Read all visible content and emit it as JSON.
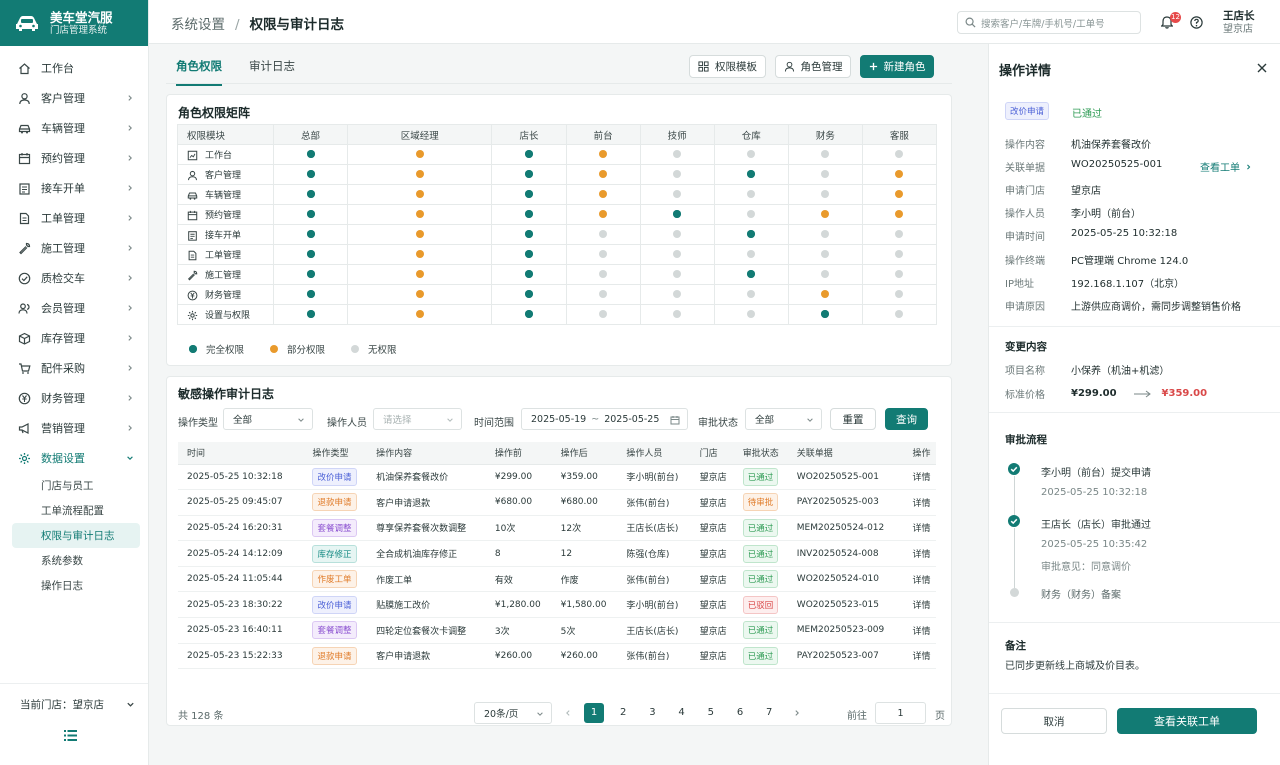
{
  "app": {
    "name": "美车堂汽服",
    "subtitle": "门店管理系统"
  },
  "sidebar": {
    "items": [
      {
        "label": "工作台",
        "icon": "home-icon"
      },
      {
        "label": "客户管理",
        "icon": "user-icon"
      },
      {
        "label": "车辆管理",
        "icon": "car-icon"
      },
      {
        "label": "预约管理",
        "icon": "calendar-icon"
      },
      {
        "label": "接车开单",
        "icon": "clipboard-icon"
      },
      {
        "label": "工单管理",
        "icon": "document-icon"
      },
      {
        "label": "施工管理",
        "icon": "wrench-icon"
      },
      {
        "label": "质检交车",
        "icon": "check-circle-icon"
      },
      {
        "label": "会员管理",
        "icon": "member-icon"
      },
      {
        "label": "库存管理",
        "icon": "box-icon"
      },
      {
        "label": "配件采购",
        "icon": "cart-icon"
      },
      {
        "label": "财务管理",
        "icon": "money-icon"
      },
      {
        "label": "营销管理",
        "icon": "megaphone-icon"
      },
      {
        "label": "数据设置",
        "icon": "gear-icon"
      }
    ],
    "sub_items": [
      "门店与员工",
      "工单流程配置",
      "权限与审计日志",
      "系统参数",
      "操作日志"
    ],
    "current_store": "当前门店：望京店"
  },
  "header": {
    "breadcrumb": [
      "系统设置",
      "权限与审计日志"
    ],
    "search_placeholder": "搜索客户/车牌/手机号/工单号",
    "notifications": "12",
    "user_name": "王店长",
    "user_store": "望京店"
  },
  "tabs": [
    "角色权限",
    "审计日志"
  ],
  "actions": {
    "template": "权限模板",
    "roles": "角色管理",
    "new_role": "新建角色"
  },
  "matrix": {
    "title": "角色权限矩阵",
    "columns": [
      "权限模块",
      "总部",
      "区域经理",
      "店长",
      "前台",
      "技师",
      "仓库",
      "财务",
      "客服"
    ],
    "rows": [
      {
        "module": "工作台",
        "icon": "dashboard-icon",
        "levels": [
          "full",
          "part",
          "full",
          "part",
          "none",
          "none",
          "none",
          "none"
        ]
      },
      {
        "module": "客户管理",
        "icon": "user-icon",
        "levels": [
          "full",
          "part",
          "full",
          "part",
          "none",
          "full",
          "none",
          "part"
        ]
      },
      {
        "module": "车辆管理",
        "icon": "car-icon",
        "levels": [
          "full",
          "part",
          "full",
          "part",
          "none",
          "none",
          "none",
          "part"
        ]
      },
      {
        "module": "预约管理",
        "icon": "calendar-icon",
        "levels": [
          "full",
          "part",
          "full",
          "part",
          "full",
          "none",
          "part",
          "part"
        ]
      },
      {
        "module": "接车开单",
        "icon": "clipboard-icon",
        "levels": [
          "full",
          "part",
          "full",
          "none",
          "none",
          "full",
          "none",
          "none"
        ]
      },
      {
        "module": "工单管理",
        "icon": "document-icon",
        "levels": [
          "full",
          "part",
          "full",
          "none",
          "none",
          "none",
          "none",
          "none"
        ]
      },
      {
        "module": "施工管理",
        "icon": "wrench-icon",
        "levels": [
          "full",
          "part",
          "full",
          "none",
          "none",
          "full",
          "none",
          "none"
        ]
      },
      {
        "module": "财务管理",
        "icon": "money-icon",
        "levels": [
          "full",
          "part",
          "full",
          "none",
          "none",
          "none",
          "part",
          "none"
        ]
      },
      {
        "module": "设置与权限",
        "icon": "gear-icon",
        "levels": [
          "full",
          "part",
          "full",
          "none",
          "none",
          "none",
          "full",
          "none"
        ]
      }
    ],
    "legend": [
      "完全权限",
      "部分权限",
      "无权限"
    ]
  },
  "audit": {
    "title": "敏感操作审计日志",
    "filters": {
      "type_label": "操作类型",
      "type_value": "全部",
      "user_label": "操作人员",
      "user_placeholder": "请选择",
      "range_label": "时间范围",
      "date_from": "2025-05-19",
      "date_to": "2025-05-25",
      "status_label": "审批状态",
      "status_value": "全部",
      "reset": "重置",
      "query": "查询"
    },
    "columns": [
      "时间",
      "操作类型",
      "操作内容",
      "操作前",
      "操作后",
      "操作人员",
      "门店",
      "审批状态",
      "关联单据",
      "操作"
    ],
    "rows": [
      {
        "time": "2025-05-25 10:32:18",
        "type": "改价申请",
        "tc": "blue",
        "content": "机油保养套餐改价",
        "before": "¥299.00",
        "after": "¥359.00",
        "user": "李小明(前台)",
        "store": "望京店",
        "status": "已通过",
        "sc": "green",
        "ref": "WO20250525-001",
        "action": "详情"
      },
      {
        "time": "2025-05-25 09:45:07",
        "type": "退款申请",
        "tc": "orange",
        "content": "客户申请退款",
        "before": "¥680.00",
        "after": "¥680.00",
        "user": "张伟(前台)",
        "store": "望京店",
        "status": "待审批",
        "sc": "orange",
        "ref": "PAY20250525-003",
        "action": "详情"
      },
      {
        "time": "2025-05-24 16:20:31",
        "type": "套餐调整",
        "tc": "purple",
        "content": "尊享保养套餐次数调整",
        "before": "10次",
        "after": "12次",
        "user": "王店长(店长)",
        "store": "望京店",
        "status": "已通过",
        "sc": "green",
        "ref": "MEM20250524-012",
        "action": "详情"
      },
      {
        "time": "2025-05-24 14:12:09",
        "type": "库存修正",
        "tc": "teal",
        "content": "全合成机油库存修正",
        "before": "8",
        "after": "12",
        "user": "陈强(仓库)",
        "store": "望京店",
        "status": "已通过",
        "sc": "green",
        "ref": "INV20250524-008",
        "action": "详情"
      },
      {
        "time": "2025-05-24 11:05:44",
        "type": "作废工单",
        "tc": "orange",
        "content": "作废工单",
        "before": "有效",
        "after": "作废",
        "user": "张伟(前台)",
        "store": "望京店",
        "status": "已通过",
        "sc": "green",
        "ref": "WO20250524-010",
        "action": "详情"
      },
      {
        "time": "2025-05-23 18:30:22",
        "type": "改价申请",
        "tc": "blue",
        "content": "贴膜施工改价",
        "before": "¥1,280.00",
        "after": "¥1,580.00",
        "user": "李小明(前台)",
        "store": "望京店",
        "status": "已驳回",
        "sc": "red",
        "ref": "WO20250523-015",
        "action": "详情"
      },
      {
        "time": "2025-05-23 16:40:11",
        "type": "套餐调整",
        "tc": "purple",
        "content": "四轮定位套餐次卡调整",
        "before": "3次",
        "after": "5次",
        "user": "王店长(店长)",
        "store": "望京店",
        "status": "已通过",
        "sc": "green",
        "ref": "MEM20250523-009",
        "action": "详情"
      },
      {
        "time": "2025-05-23 15:22:33",
        "type": "退款申请",
        "tc": "orange",
        "content": "客户申请退款",
        "before": "¥260.00",
        "after": "¥260.00",
        "user": "张伟(前台)",
        "store": "望京店",
        "status": "已通过",
        "sc": "green",
        "ref": "PAY20250523-007",
        "action": "详情"
      }
    ],
    "pager": {
      "total": "共 128 条",
      "size": "20条/页",
      "pages": [
        "1",
        "2",
        "3",
        "4",
        "5",
        "6",
        "7"
      ],
      "goto": "前往",
      "goto_value": "1",
      "page_unit": "页"
    }
  },
  "detail": {
    "title": "操作详情",
    "type_tag": "改价申请",
    "status": "已通过",
    "fields": [
      {
        "k": "操作内容",
        "v": "机油保养套餐改价"
      },
      {
        "k": "关联单据",
        "v": "WO20250525-001"
      },
      {
        "k": "申请门店",
        "v": "望京店"
      },
      {
        "k": "操作人员",
        "v": "李小明（前台）"
      },
      {
        "k": "申请时间",
        "v": "2025-05-25 10:32:18"
      },
      {
        "k": "操作终端",
        "v": "PC管理端    Chrome 124.0"
      },
      {
        "k": "IP地址",
        "v": "192.168.1.107（北京）"
      },
      {
        "k": "申请原因",
        "v": "上游供应商调价，需同步调整销售价格"
      }
    ],
    "view_order": "查看工单",
    "change_title": "变更内容",
    "item_label": "项目名称",
    "item_value": "小保养（机油+机滤）",
    "price_label": "标准价格",
    "price_before": "¥299.00",
    "price_after": "¥359.00",
    "flow_title": "审批流程",
    "flow": [
      {
        "text": "李小明（前台）提交申请",
        "time": "2025-05-25 10:32:18"
      },
      {
        "text": "王店长（店长）审批通过",
        "time": "2025-05-25 10:35:42",
        "opinion": "审批意见：同意调价"
      },
      {
        "text": "财务（财务）备案"
      }
    ],
    "note_title": "备注",
    "note": "已同步更新线上商城及价目表。",
    "cancel": "取消",
    "view_linked": "查看关联工单"
  }
}
